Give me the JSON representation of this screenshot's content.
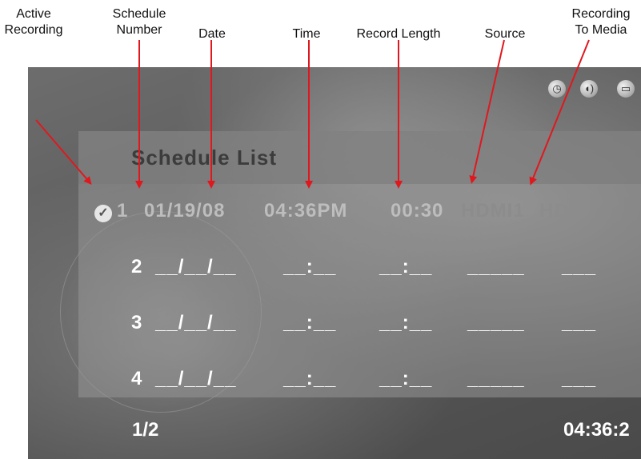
{
  "callouts": {
    "active_recording": [
      "Active",
      "Recording"
    ],
    "schedule_number": [
      "Schedule",
      "Number"
    ],
    "date": "Date",
    "time": "Time",
    "record_length": "Record Length",
    "source": "Source",
    "recording_to_media": [
      "Recording",
      "To Media"
    ]
  },
  "screen": {
    "title": "Schedule List",
    "status_icons": [
      "clock-icon",
      "speaker-icon",
      "hard-disk-icon"
    ],
    "rows": [
      {
        "num": "1",
        "date": "01/19/08",
        "time": "04:36PM",
        "length": "00:30",
        "source": "HDMI1",
        "media": "HDD",
        "active": true
      },
      {
        "num": "2",
        "date": "__/__/__",
        "time": "__:__",
        "length": "__:__",
        "source": "_____",
        "media": "___",
        "active": false
      },
      {
        "num": "3",
        "date": "__/__/__",
        "time": "__:__",
        "length": "__:__",
        "source": "_____",
        "media": "___",
        "active": false
      },
      {
        "num": "4",
        "date": "__/__/__",
        "time": "__:__",
        "length": "__:__",
        "source": "_____",
        "media": "___",
        "active": false
      }
    ],
    "page_indicator": "1/2",
    "clock": "04:36:2"
  }
}
